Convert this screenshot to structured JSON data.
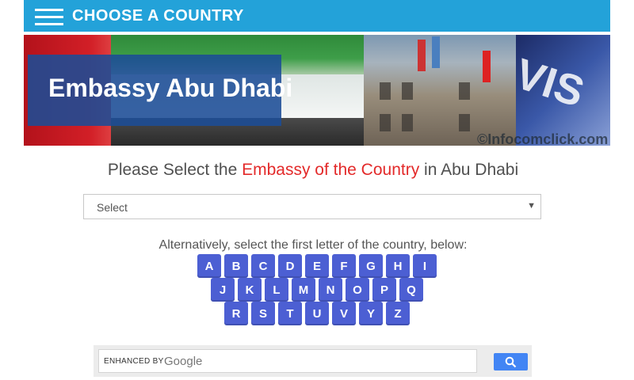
{
  "header": {
    "title": "CHOOSE A COUNTRY",
    "menu_icon": "hamburger-menu-icon"
  },
  "banner": {
    "title": "Embassy Abu Dhabi",
    "watermark": "©Infocomclick.com",
    "visa_text": "VIS"
  },
  "heading": {
    "prefix": "Please Select the ",
    "accent": "Embassy of the Country",
    "suffix": " in Abu Dhabi",
    "accent_color": "#e32a2a"
  },
  "country_select": {
    "value": "Select"
  },
  "alphabet": {
    "instruction": "Alternatively, select the first letter of the country, below:",
    "rows": [
      [
        "A",
        "B",
        "C",
        "D",
        "E",
        "F",
        "G",
        "H",
        "I"
      ],
      [
        "J",
        "K",
        "L",
        "M",
        "N",
        "O",
        "P",
        "Q"
      ],
      [
        "R",
        "S",
        "T",
        "U",
        "V",
        "Y",
        "Z"
      ]
    ],
    "button_color": "#4c5fd3"
  },
  "search": {
    "enhanced_label": "ENHANCED BY",
    "brand": "Google",
    "button_icon": "search-icon"
  },
  "colors": {
    "topbar": "#23a2d9",
    "banner_box": "#1b4c96"
  }
}
